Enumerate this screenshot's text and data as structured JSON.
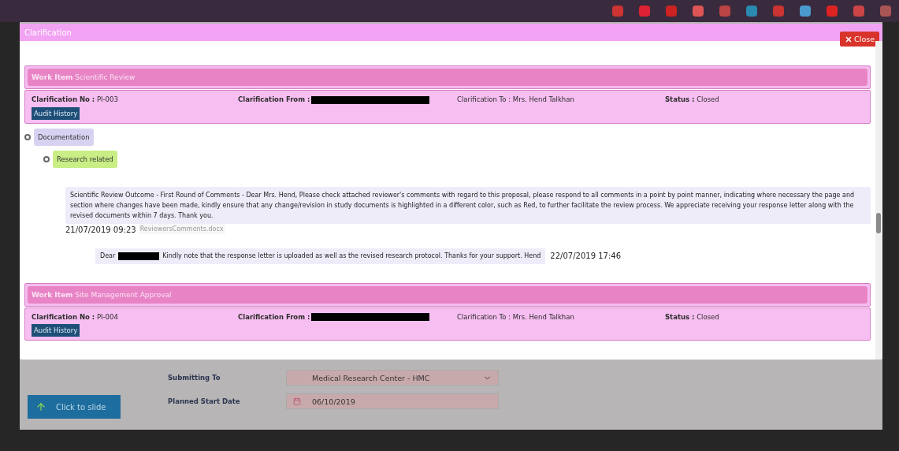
{
  "dialog": {
    "title": "Clarification",
    "close_label": "Close"
  },
  "clarifications": [
    {
      "work_item_label": "Work Item",
      "work_item": "Scientific Review",
      "no_label": "Clarification No :",
      "no": "PI-003",
      "from_label": "Clarification From :",
      "to_label": "Clarification To :",
      "to": "Mrs. Hend Talkhan",
      "status_label": "Status :",
      "status": "Closed",
      "audit_label": "Audit History",
      "tree": [
        {
          "label": "Documentation",
          "color": "#d8d2f2",
          "expanded": true,
          "children": [
            {
              "label": "Research related",
              "color": "#c9ee86",
              "expanded": true,
              "comments": [
                {
                  "text": "Scientific Review Outcome - First Round of Comments - Dear Mrs. Hend, Please check attached reviewer's comments with regard to this proposal, please respond to all comments in a point by point manner, indicating where necessary the page and section where changes have been made, kindly ensure that any change/revision in study documents is highlighted in a different color, such as Red, to further facilitate the review process. We appreciate receiving your response letter along with the revised documents within 7 days. Thank you.",
                  "date": "21/07/2019 09:23",
                  "attachment": "ReviewersComments.docx",
                  "replies": [
                    {
                      "greeting": "Dear",
                      "text": "Kindly note that the response letter is uploaded as well as the revised research protocol. Thanks for your support. Hend",
                      "date": "22/07/2019 17:46"
                    }
                  ]
                }
              ]
            }
          ]
        }
      ]
    },
    {
      "work_item_label": "Work Item",
      "work_item": "Site Management Approval",
      "no_label": "Clarification No :",
      "no": "PI-004",
      "from_label": "Clarification From :",
      "to_label": "Clarification To :",
      "to": "Mrs. Hend Talkhan",
      "status_label": "Status :",
      "status": "Closed",
      "audit_label": "Audit History"
    }
  ],
  "background_form": {
    "fields": [
      {
        "label": "Submitting To",
        "kind": "select",
        "value": "Medical Research Center - HMC"
      },
      {
        "label": "Planned Start Date",
        "kind": "date",
        "value": "06/10/2019"
      }
    ],
    "slide_button": "Click to slide"
  }
}
